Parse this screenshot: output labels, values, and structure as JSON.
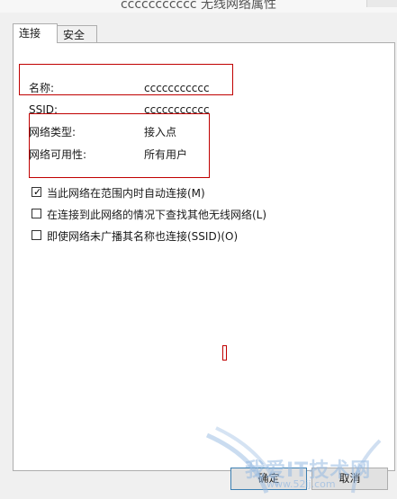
{
  "window": {
    "title": "ccccccccccc 无线网络属性"
  },
  "tabs": [
    {
      "label": "连接",
      "active": true
    },
    {
      "label": "安全",
      "active": false
    }
  ],
  "info": {
    "name_label": "名称:",
    "name_value": "ccccccccccc",
    "ssid_label": "SSID:",
    "ssid_value": "ccccccccccc",
    "type_label": "网络类型:",
    "type_value": "接入点",
    "avail_label": "网络可用性:",
    "avail_value": "所有用户"
  },
  "options": [
    {
      "label": "当此网络在范围内时自动连接(M)",
      "checked": true
    },
    {
      "label": "在连接到此网络的情况下查找其他无线网络(L)",
      "checked": false
    },
    {
      "label": "即使网络未广播其名称也连接(SSID)(O)",
      "checked": false
    }
  ],
  "buttons": {
    "ok": "确定",
    "cancel": "取消"
  },
  "watermark": {
    "text": "我爱IT技术网",
    "url": "www.52ij.com"
  },
  "colors": {
    "annotation_red": "#c00000",
    "focus_blue": "#3c7fb1"
  }
}
